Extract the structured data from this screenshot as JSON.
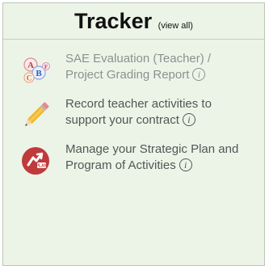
{
  "tracker": {
    "title": "Tracker",
    "view_all": "(view all)",
    "items": [
      {
        "line1": "SAE Evaluation (Teacher) /",
        "line2": "Project Grading Report",
        "info": "i",
        "icon": "abc-blocks-icon",
        "text_color": "#8f8f8f"
      },
      {
        "line1": "Record teacher activities to",
        "line2": "support your contract",
        "info": "i",
        "icon": "pencil-icon",
        "text_color": "#555555"
      },
      {
        "line1": "Manage your Strategic Plan and",
        "line2": "Program of Activities",
        "info": "i",
        "icon": "plan-icon",
        "text_color": "#555555"
      }
    ]
  },
  "colors": {
    "panel_background": "#ecf4e8",
    "panel_border": "#b9c6b4",
    "plan_icon_red": "#c0393b"
  }
}
